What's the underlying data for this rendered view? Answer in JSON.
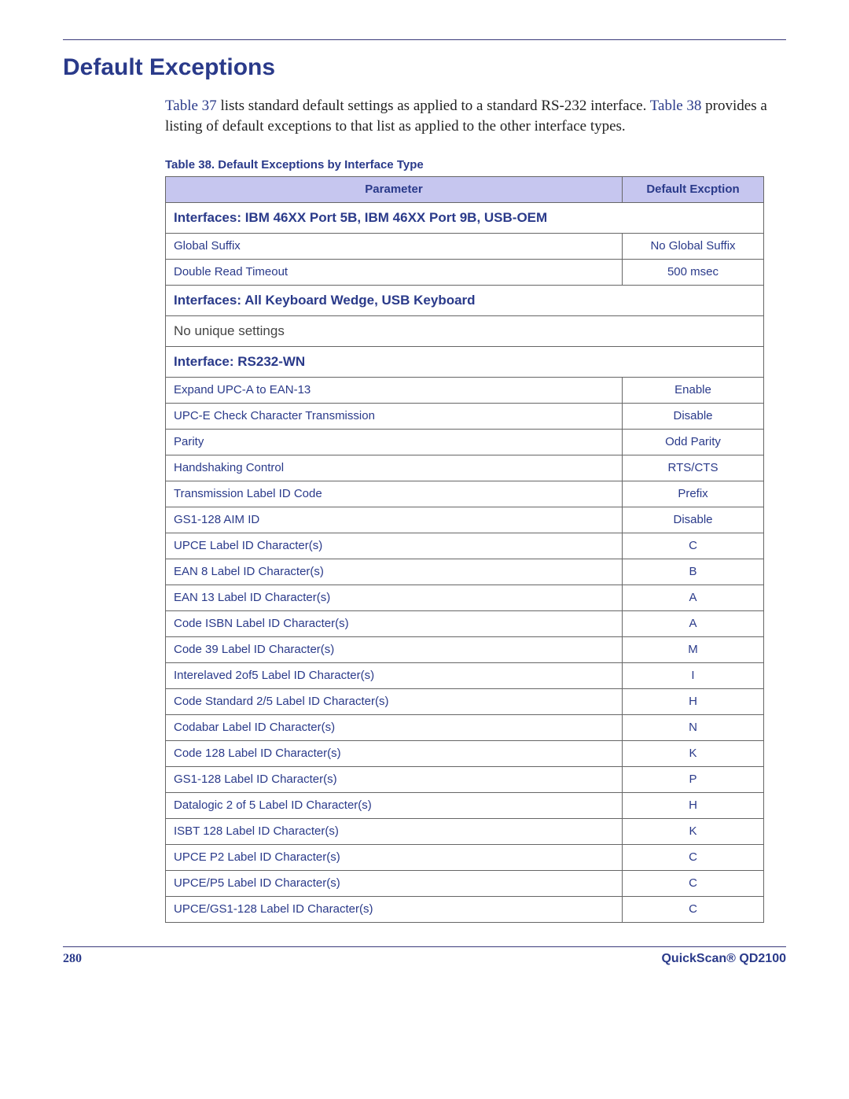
{
  "heading": "Default Exceptions",
  "intro_parts": {
    "t37": "Table 37",
    "s1": " lists standard default settings as applied to a standard RS-232 interface. ",
    "t38": "Table 38",
    "s2": " provides a listing of default exceptions to that list as applied to the other interface types."
  },
  "table_caption": "Table 38. Default Exceptions by Interface Type",
  "columns": {
    "parameter": "Parameter",
    "default": "Default Excption"
  },
  "sections": [
    {
      "title": "Interfaces: IBM 46XX Port 5B, IBM 46XX Port 9B, USB-OEM",
      "kind": "section",
      "rows": [
        {
          "param": "Global Suffix",
          "val": "No Global Suffix"
        },
        {
          "param": "Double Read Timeout",
          "val": "500 msec"
        }
      ]
    },
    {
      "title": "Interfaces: All Keyboard Wedge, USB Keyboard",
      "kind": "section",
      "rows": []
    },
    {
      "title": "No unique settings",
      "kind": "plain",
      "rows": []
    },
    {
      "title": "Interface: RS232-WN",
      "kind": "section",
      "rows": [
        {
          "param": "Expand UPC-A to EAN-13",
          "val": "Enable"
        },
        {
          "param": "UPC-E Check Character Transmission",
          "val": "Disable"
        },
        {
          "param": "Parity",
          "val": "Odd Parity"
        },
        {
          "param": "Handshaking Control",
          "val": "RTS/CTS"
        },
        {
          "param": "Transmission Label ID Code",
          "val": "Prefix"
        },
        {
          "param": "GS1-128 AIM ID",
          "val": "Disable"
        },
        {
          "param": "UPCE Label ID Character(s)",
          "val": "C"
        },
        {
          "param": "EAN 8 Label ID Character(s)",
          "val": "B"
        },
        {
          "param": "EAN 13 Label ID Character(s)",
          "val": "A"
        },
        {
          "param": "Code ISBN Label ID Character(s)",
          "val": "A"
        },
        {
          "param": "Code 39 Label ID Character(s)",
          "val": "M"
        },
        {
          "param": "Interelaved 2of5 Label ID Character(s)",
          "val": "I"
        },
        {
          "param": "Code Standard 2/5 Label ID Character(s)",
          "val": "H"
        },
        {
          "param": "Codabar Label ID Character(s)",
          "val": "N"
        },
        {
          "param": "Code 128 Label ID Character(s)",
          "val": "K"
        },
        {
          "param": "GS1-128 Label ID Character(s)",
          "val": "P"
        },
        {
          "param": "Datalogic 2 of 5 Label ID Character(s)",
          "val": "H"
        },
        {
          "param": "ISBT 128 Label ID Character(s)",
          "val": "K"
        },
        {
          "param": "UPCE P2 Label ID Character(s)",
          "val": "C"
        },
        {
          "param": "UPCE/P5 Label ID Character(s)",
          "val": "C"
        },
        {
          "param": "UPCE/GS1-128 Label ID Character(s)",
          "val": "C"
        }
      ]
    }
  ],
  "footer": {
    "page": "280",
    "product": "QuickScan® QD2100"
  }
}
